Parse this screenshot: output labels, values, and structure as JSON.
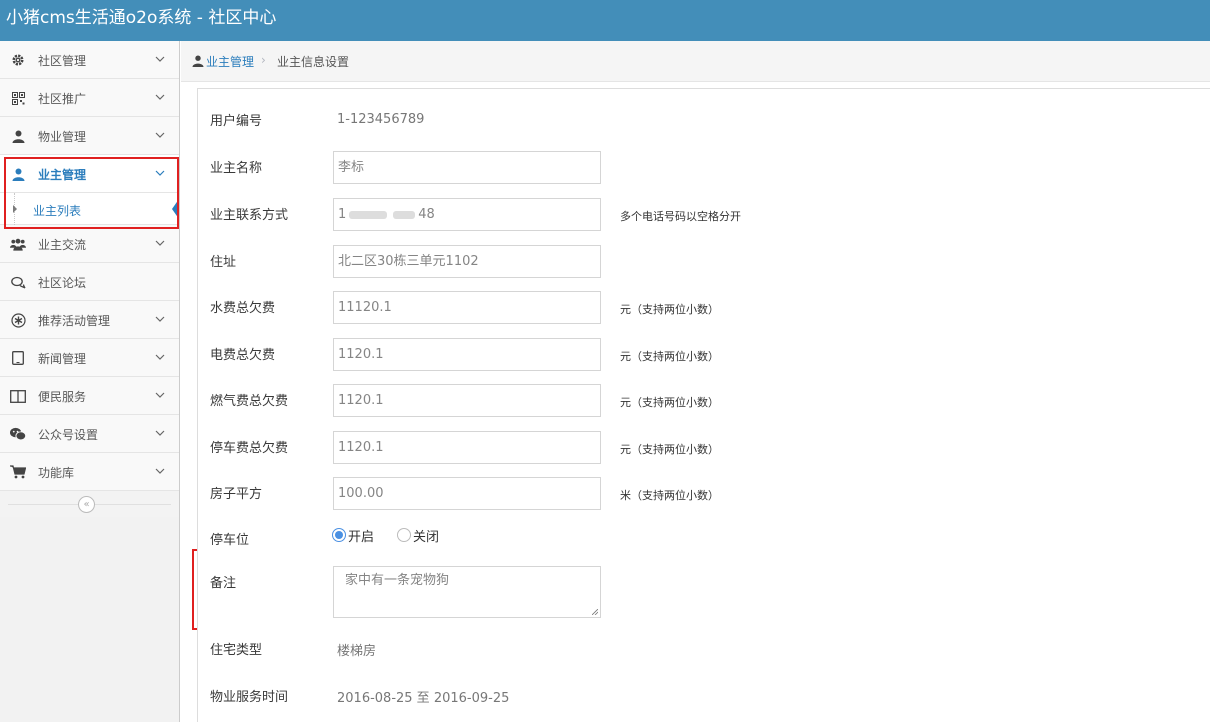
{
  "app": {
    "title": "小猪cms生活通o2o系统 - 社区中心"
  },
  "sidebar": {
    "items": [
      {
        "label": "社区管理",
        "icon": "gear-icon"
      },
      {
        "label": "社区推广",
        "icon": "qrcode-icon"
      },
      {
        "label": "物业管理",
        "icon": "user-icon"
      },
      {
        "label": "业主管理",
        "icon": "user-icon",
        "active": true
      },
      {
        "label": "业主交流",
        "icon": "group-icon"
      },
      {
        "label": "社区论坛",
        "icon": "comments-icon"
      },
      {
        "label": "推荐活动管理",
        "icon": "asterisk-circle-icon"
      },
      {
        "label": "新闻管理",
        "icon": "tablet-icon"
      },
      {
        "label": "便民服务",
        "icon": "columns-icon"
      },
      {
        "label": "公众号设置",
        "icon": "wechat-icon"
      },
      {
        "label": "功能库",
        "icon": "cart-icon"
      }
    ],
    "subitem": {
      "label": "业主列表"
    },
    "collapse_icon": "double-chevron-left-icon"
  },
  "breadcrumb": {
    "parent": "业主管理",
    "separator": "›",
    "current": "业主信息设置"
  },
  "form": {
    "user_id": {
      "label": "用户编号",
      "value": "1-123456789"
    },
    "owner_name": {
      "label": "业主名称",
      "value": "李标"
    },
    "phone": {
      "label": "业主联系方式",
      "value_prefix": "1",
      "value_suffix": "48",
      "hint": "多个电话号码以空格分开"
    },
    "address": {
      "label": "住址",
      "value": "北二区30栋三单元1102"
    },
    "water": {
      "label": "水费总欠费",
      "value": "11120.1",
      "hint": "元（支持两位小数）"
    },
    "electric": {
      "label": "电费总欠费",
      "value": "1120.1",
      "hint": "元（支持两位小数）"
    },
    "gas": {
      "label": "燃气费总欠费",
      "value": "1120.1",
      "hint": "元（支持两位小数）"
    },
    "parking_fee": {
      "label": "停车费总欠费",
      "value": "1120.1",
      "hint": "元（支持两位小数）"
    },
    "area": {
      "label": "房子平方",
      "value": "100.00",
      "hint": "米（支持两位小数）"
    },
    "parking": {
      "label": "停车位",
      "option_on": "开启",
      "option_off": "关闭",
      "selected": "开启"
    },
    "remark": {
      "label": "备注",
      "value": "家中有一条宠物狗"
    },
    "house_type": {
      "label": "住宅类型",
      "value": "楼梯房"
    },
    "service_time": {
      "label": "物业服务时间",
      "value": "2016-08-25 至 2016-09-25"
    }
  },
  "colors": {
    "header": "#438eb9",
    "accent": "#2b7dbc",
    "highlight": "#e02020",
    "radio": "#4a90e2"
  }
}
